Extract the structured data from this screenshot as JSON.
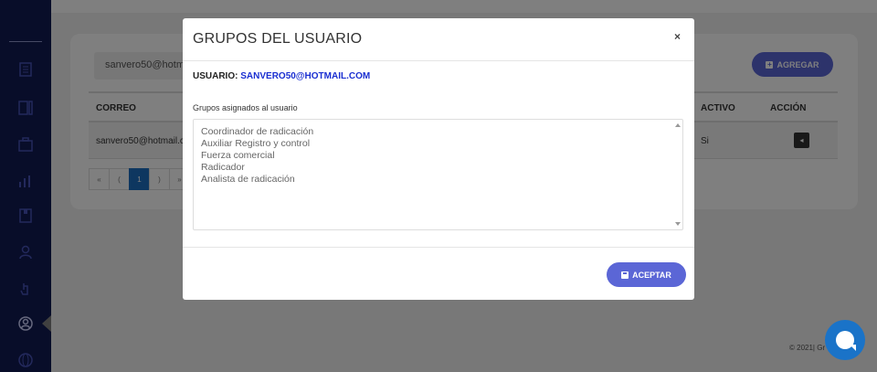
{
  "background": {
    "filter_value": "sanvero50@hotm",
    "add_button_label": "AGREGAR",
    "table": {
      "headers": [
        "CORREO",
        "ACTIVO",
        "ACCIÓN"
      ],
      "row": {
        "correo": "sanvero50@hotmail.c",
        "activo": "Si",
        "action_icon": "◂"
      }
    },
    "pager": [
      "«",
      "(",
      "1",
      ")",
      "»"
    ],
    "footer": "© 2021| Gr"
  },
  "modal": {
    "title": "GRUPOS DEL USUARIO",
    "close_label": "×",
    "user_label": "USUARIO:",
    "user_email": "SANVERO50@HOTMAIL.COM",
    "groups_label": "Grupos asignados al usuario",
    "groups": [
      "Coordinador de radicación",
      "Auxiliar Registro y control",
      "Fuerza comercial",
      "Radicador",
      "Analista de radicación"
    ],
    "accept_label": "ACEPTAR"
  },
  "colors": {
    "sidebar": "#111a52",
    "accent": "#5b66d6",
    "email": "#1a2fd1",
    "chat": "#1a73c8"
  }
}
